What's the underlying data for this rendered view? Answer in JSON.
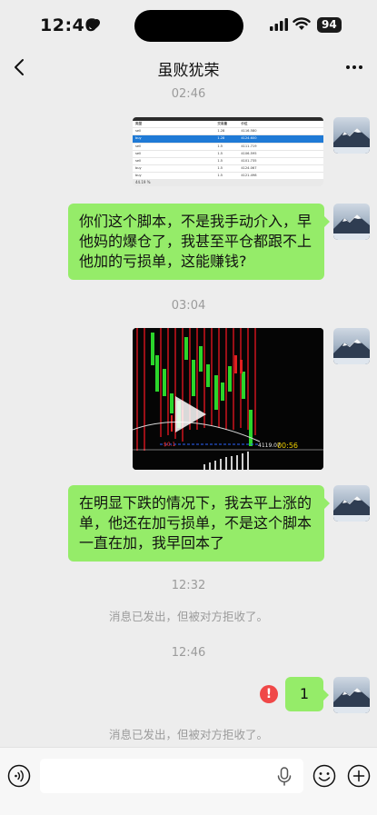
{
  "status": {
    "time": "12:46",
    "battery": "94"
  },
  "nav": {
    "title": "虽败犹荣"
  },
  "messages": {
    "t1": "02:46",
    "m1": "你们这个脚本，不是我手动介入，早他妈的爆仓了，我甚至平仓都跟不上他加的亏损单，这能赚钱?",
    "t2": "03:04",
    "video_duration": "00:56",
    "m2": "在明显下跌的情况下，我去平上涨的单，他还在加亏损单，不是这个脚本一直在加，我早回本了",
    "t3": "12:32",
    "sys1": "消息已发出，但被对方拒收了。",
    "t4": "12:46",
    "m3": "1",
    "sys2": "消息已发出，但被对方拒收了。"
  },
  "screenshot_table": {
    "headers": [
      "类型",
      "交易量",
      "价位"
    ],
    "rows": [
      [
        "sell",
        "1.28",
        "4116.580"
      ],
      [
        "buy",
        "1.28",
        "4124.600"
      ],
      [
        "sell",
        "1.5",
        "4111.719"
      ],
      [
        "sell",
        "1.5",
        "4106.595"
      ],
      [
        "sell",
        "1.5",
        "4101.735"
      ],
      [
        "buy",
        "1.5",
        "4124.067"
      ],
      [
        "buy",
        "1.5",
        "4121.498"
      ]
    ],
    "footer": "44.19 %"
  },
  "video_overlay": {
    "price_label": "4119.07"
  },
  "colors": {
    "bubble": "#95ec69",
    "background": "#ededed",
    "error": "#f04848"
  }
}
